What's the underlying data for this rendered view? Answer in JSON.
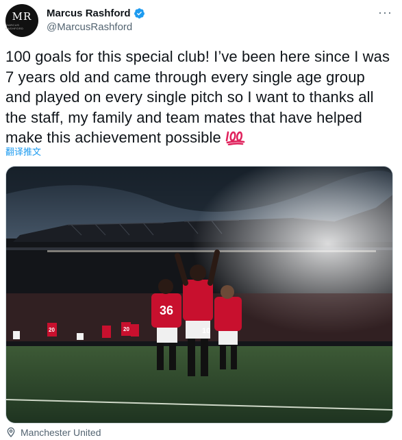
{
  "author": {
    "display_name": "Marcus Rashford",
    "handle": "@MarcusRashford",
    "verified": true,
    "avatar_monogram": "MR",
    "avatar_caption": "MARCUS RASHFORD"
  },
  "menu_icon": "more-dots-icon",
  "tweet": {
    "text": "100 goals for this special club! I’ve been here since I was 7 years old and came through every single age group and played on every single pitch so I want to thanks all the staff, my family and team mates that have helped make this achievement possible",
    "emoji": "hundred-points-emoji"
  },
  "translate_label": "翻译推文",
  "media": {
    "kind": "photo",
    "jersey_numbers": [
      "36",
      "10",
      "20",
      "20"
    ]
  },
  "location": {
    "label": "Manchester United",
    "icon": "location-pin-icon"
  },
  "colors": {
    "link": "#1d9bf0",
    "muted": "#536471",
    "verified": "#1d9bf0",
    "kit_red": "#c8102e"
  }
}
